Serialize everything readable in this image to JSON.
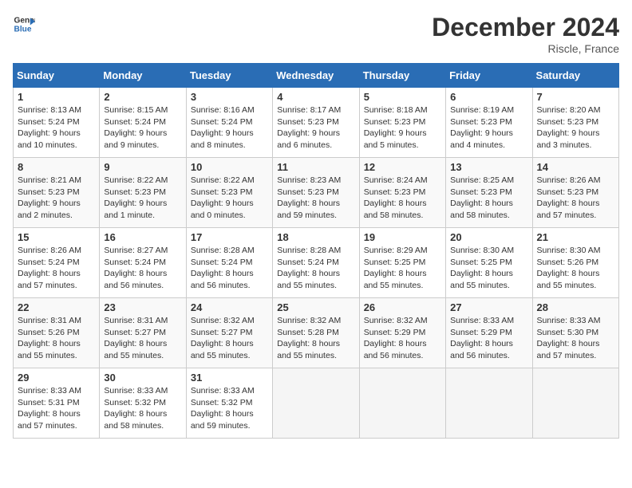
{
  "header": {
    "logo_line1": "General",
    "logo_line2": "Blue",
    "month": "December 2024",
    "location": "Riscle, France"
  },
  "days_of_week": [
    "Sunday",
    "Monday",
    "Tuesday",
    "Wednesday",
    "Thursday",
    "Friday",
    "Saturday"
  ],
  "weeks": [
    [
      {
        "day": "1",
        "info": "Sunrise: 8:13 AM\nSunset: 5:24 PM\nDaylight: 9 hours\nand 10 minutes."
      },
      {
        "day": "2",
        "info": "Sunrise: 8:15 AM\nSunset: 5:24 PM\nDaylight: 9 hours\nand 9 minutes."
      },
      {
        "day": "3",
        "info": "Sunrise: 8:16 AM\nSunset: 5:24 PM\nDaylight: 9 hours\nand 8 minutes."
      },
      {
        "day": "4",
        "info": "Sunrise: 8:17 AM\nSunset: 5:23 PM\nDaylight: 9 hours\nand 6 minutes."
      },
      {
        "day": "5",
        "info": "Sunrise: 8:18 AM\nSunset: 5:23 PM\nDaylight: 9 hours\nand 5 minutes."
      },
      {
        "day": "6",
        "info": "Sunrise: 8:19 AM\nSunset: 5:23 PM\nDaylight: 9 hours\nand 4 minutes."
      },
      {
        "day": "7",
        "info": "Sunrise: 8:20 AM\nSunset: 5:23 PM\nDaylight: 9 hours\nand 3 minutes."
      }
    ],
    [
      {
        "day": "8",
        "info": "Sunrise: 8:21 AM\nSunset: 5:23 PM\nDaylight: 9 hours\nand 2 minutes."
      },
      {
        "day": "9",
        "info": "Sunrise: 8:22 AM\nSunset: 5:23 PM\nDaylight: 9 hours\nand 1 minute."
      },
      {
        "day": "10",
        "info": "Sunrise: 8:22 AM\nSunset: 5:23 PM\nDaylight: 9 hours\nand 0 minutes."
      },
      {
        "day": "11",
        "info": "Sunrise: 8:23 AM\nSunset: 5:23 PM\nDaylight: 8 hours\nand 59 minutes."
      },
      {
        "day": "12",
        "info": "Sunrise: 8:24 AM\nSunset: 5:23 PM\nDaylight: 8 hours\nand 58 minutes."
      },
      {
        "day": "13",
        "info": "Sunrise: 8:25 AM\nSunset: 5:23 PM\nDaylight: 8 hours\nand 58 minutes."
      },
      {
        "day": "14",
        "info": "Sunrise: 8:26 AM\nSunset: 5:23 PM\nDaylight: 8 hours\nand 57 minutes."
      }
    ],
    [
      {
        "day": "15",
        "info": "Sunrise: 8:26 AM\nSunset: 5:24 PM\nDaylight: 8 hours\nand 57 minutes."
      },
      {
        "day": "16",
        "info": "Sunrise: 8:27 AM\nSunset: 5:24 PM\nDaylight: 8 hours\nand 56 minutes."
      },
      {
        "day": "17",
        "info": "Sunrise: 8:28 AM\nSunset: 5:24 PM\nDaylight: 8 hours\nand 56 minutes."
      },
      {
        "day": "18",
        "info": "Sunrise: 8:28 AM\nSunset: 5:24 PM\nDaylight: 8 hours\nand 55 minutes."
      },
      {
        "day": "19",
        "info": "Sunrise: 8:29 AM\nSunset: 5:25 PM\nDaylight: 8 hours\nand 55 minutes."
      },
      {
        "day": "20",
        "info": "Sunrise: 8:30 AM\nSunset: 5:25 PM\nDaylight: 8 hours\nand 55 minutes."
      },
      {
        "day": "21",
        "info": "Sunrise: 8:30 AM\nSunset: 5:26 PM\nDaylight: 8 hours\nand 55 minutes."
      }
    ],
    [
      {
        "day": "22",
        "info": "Sunrise: 8:31 AM\nSunset: 5:26 PM\nDaylight: 8 hours\nand 55 minutes."
      },
      {
        "day": "23",
        "info": "Sunrise: 8:31 AM\nSunset: 5:27 PM\nDaylight: 8 hours\nand 55 minutes."
      },
      {
        "day": "24",
        "info": "Sunrise: 8:32 AM\nSunset: 5:27 PM\nDaylight: 8 hours\nand 55 minutes."
      },
      {
        "day": "25",
        "info": "Sunrise: 8:32 AM\nSunset: 5:28 PM\nDaylight: 8 hours\nand 55 minutes."
      },
      {
        "day": "26",
        "info": "Sunrise: 8:32 AM\nSunset: 5:29 PM\nDaylight: 8 hours\nand 56 minutes."
      },
      {
        "day": "27",
        "info": "Sunrise: 8:33 AM\nSunset: 5:29 PM\nDaylight: 8 hours\nand 56 minutes."
      },
      {
        "day": "28",
        "info": "Sunrise: 8:33 AM\nSunset: 5:30 PM\nDaylight: 8 hours\nand 57 minutes."
      }
    ],
    [
      {
        "day": "29",
        "info": "Sunrise: 8:33 AM\nSunset: 5:31 PM\nDaylight: 8 hours\nand 57 minutes."
      },
      {
        "day": "30",
        "info": "Sunrise: 8:33 AM\nSunset: 5:32 PM\nDaylight: 8 hours\nand 58 minutes."
      },
      {
        "day": "31",
        "info": "Sunrise: 8:33 AM\nSunset: 5:32 PM\nDaylight: 8 hours\nand 59 minutes."
      },
      {
        "day": "",
        "info": ""
      },
      {
        "day": "",
        "info": ""
      },
      {
        "day": "",
        "info": ""
      },
      {
        "day": "",
        "info": ""
      }
    ]
  ]
}
